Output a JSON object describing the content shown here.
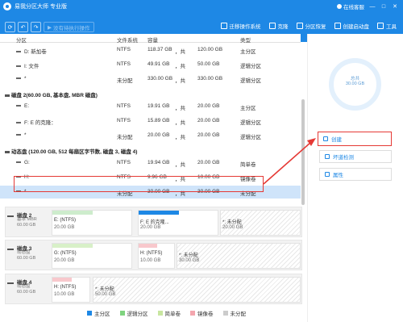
{
  "app": {
    "title": "易我分区大师 专业版",
    "user": "在线客服",
    "controls": [
      "—",
      "□",
      "✕"
    ]
  },
  "toolbar": {
    "undo_all": "没有待执行操作",
    "right": [
      {
        "label": "迁移操作系统",
        "icon": "migrate-os-icon"
      },
      {
        "label": "克隆",
        "icon": "clone-icon"
      },
      {
        "label": "分区恢复",
        "icon": "partition-recovery-icon"
      },
      {
        "label": "创建启动盘",
        "icon": "bootable-media-icon"
      },
      {
        "label": "工具",
        "icon": "tools-icon"
      }
    ]
  },
  "table": {
    "headers": [
      "分区",
      "文件系统",
      "容量",
      "类型"
    ],
    "rows": [
      {
        "kind": "part",
        "name": "D: 新加卷",
        "fs": "NTFS",
        "used": "118.37 GB",
        "free": "120.00 GB",
        "type": "主分区"
      },
      {
        "kind": "part",
        "name": "I: 文件",
        "fs": "NTFS",
        "used": "49.91 GB",
        "free": "50.00 GB",
        "type": "逻辑分区"
      },
      {
        "kind": "part",
        "name": "*",
        "fs": "未分配",
        "used": "330.00 GB",
        "free": "330.00 GB",
        "type": "逻辑分区"
      },
      {
        "kind": "group",
        "name": "磁盘 2(60.00 GB, 基本盘, MBR 磁盘)"
      },
      {
        "kind": "part",
        "name": "E:",
        "fs": "NTFS",
        "used": "19.91 GB",
        "free": "20.00 GB",
        "type": "主分区"
      },
      {
        "kind": "part",
        "name": "F: E 的克隆：",
        "fs": "NTFS",
        "used": "15.89 GB",
        "free": "20.00 GB",
        "type": "逻辑分区"
      },
      {
        "kind": "part",
        "name": "*",
        "fs": "未分配",
        "used": "20.00 GB",
        "free": "20.00 GB",
        "type": "逻辑分区"
      },
      {
        "kind": "group",
        "name": "动态盘 (120.00 GB, 512 每扇区字节数, 磁盘 3, 磁盘 4)"
      },
      {
        "kind": "part",
        "name": "G:",
        "fs": "NTFS",
        "used": "19.94 GB",
        "free": "20.00 GB",
        "type": "简单卷"
      },
      {
        "kind": "part",
        "name": "H:",
        "fs": "NTFS",
        "used": "9.96 GB",
        "free": "10.00 GB",
        "type": "镜像卷"
      },
      {
        "kind": "part",
        "name": "*",
        "fs": "未分配",
        "used": "30.00 GB",
        "free": "30.00 GB",
        "type": "未分配",
        "selected": true
      }
    ],
    "sep": "，共"
  },
  "disks": [
    {
      "name": "磁盘 2",
      "sub1": "基本 MBR",
      "sub2": "60.00 GB",
      "segs": [
        {
          "l1": "E: (NTFS)",
          "l2": "20.00 GB",
          "cap": "#cdeccc"
        },
        {
          "l1": "F: E 的克隆...",
          "l2": "20.00 GB",
          "cap": "#1e88e5"
        },
        {
          "l1": "*: 未分配",
          "l2": "20.00 GB",
          "hatch": true
        }
      ]
    },
    {
      "name": "磁盘 3",
      "sub1": "动态盘",
      "sub2": "60.00 GB",
      "segs": [
        {
          "l1": "G: (NTFS)",
          "l2": "20.00 GB",
          "cap": "#d8f0c8"
        },
        {
          "l1": "H: (NTFS)",
          "l2": "10.00 GB",
          "cap": "#f8c8cc"
        },
        {
          "l1": "*: 未分配",
          "l2": "30.00 GB",
          "hatch": true
        }
      ]
    },
    {
      "name": "磁盘 4",
      "sub1": "动态盘",
      "sub2": "60.00 GB",
      "segs": [
        {
          "l1": "H: (NTFS)",
          "l2": "10.00 GB",
          "cap": "#f8c8cc"
        },
        {
          "l1": "*: 未分配",
          "l2": "50.00 GB",
          "hatch": true
        }
      ]
    }
  ],
  "legend": [
    {
      "label": "主分区",
      "color": "#1e88e5"
    },
    {
      "label": "逻辑分区",
      "color": "#7fd37f"
    },
    {
      "label": "简单卷",
      "color": "#c8e6a0"
    },
    {
      "label": "镜像卷",
      "color": "#f4a6ae"
    },
    {
      "label": "未分配",
      "color": "#cccccc"
    }
  ],
  "side": {
    "ring_title": "总共",
    "ring_value": "30.00 GB",
    "buttons": [
      {
        "label": "创建",
        "icon": "create-icon",
        "highlight": true
      },
      {
        "label": "坏道检测",
        "icon": "surface-test-icon"
      },
      {
        "label": "属性",
        "icon": "properties-icon"
      }
    ]
  }
}
